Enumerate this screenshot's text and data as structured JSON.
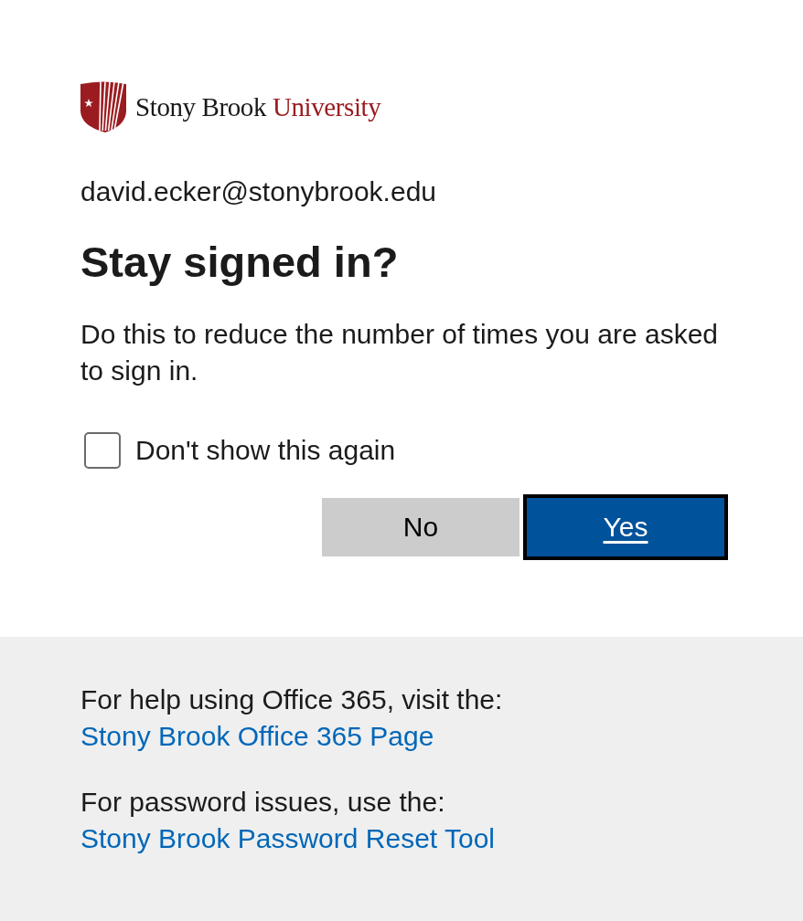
{
  "logo": {
    "name": "Stony Brook",
    "accent": "University"
  },
  "identity": "david.ecker@stonybrook.edu",
  "title": "Stay signed in?",
  "description": "Do this to reduce the number of times you are asked to sign in.",
  "checkbox": {
    "label": "Don't show this again",
    "checked": false
  },
  "buttons": [
    {
      "kind": "secondary",
      "label": "No",
      "focused": false
    },
    {
      "kind": "primary",
      "label": "Yes",
      "focused": true
    }
  ],
  "help": [
    {
      "text": "For help using Office 365, visit the:",
      "link": "Stony Brook Office 365 Page"
    },
    {
      "text": "For password issues, use the:",
      "link": "Stony Brook Password Reset Tool"
    }
  ]
}
